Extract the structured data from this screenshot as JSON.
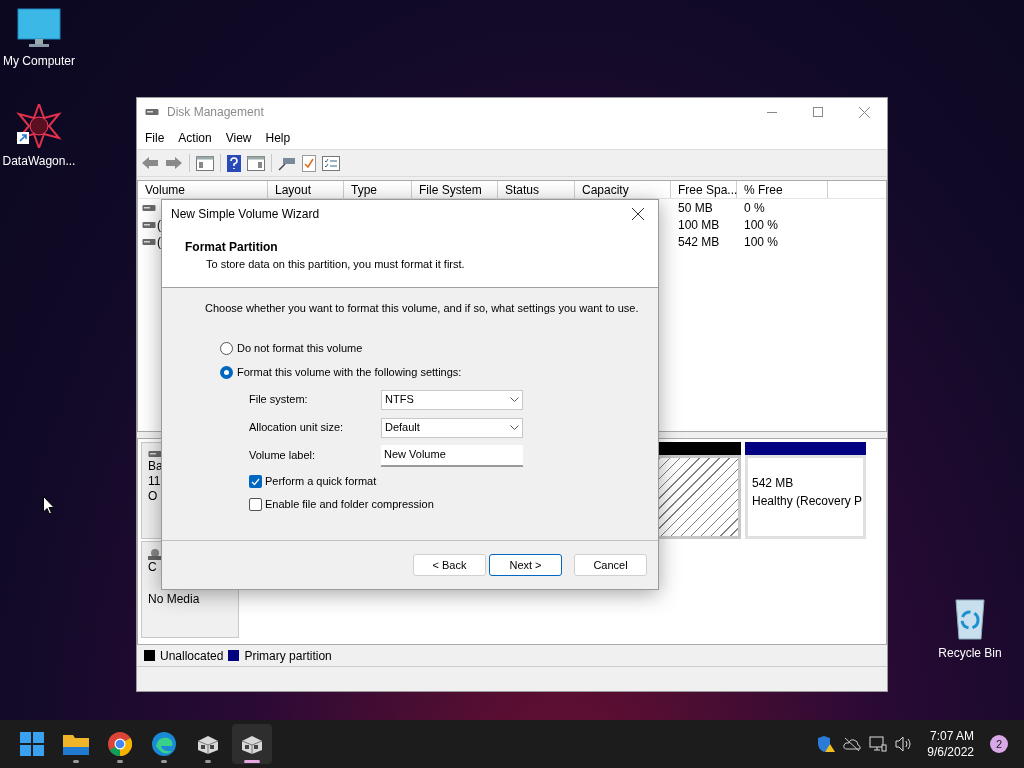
{
  "desktop_icons": [
    {
      "kind": "computer",
      "label": "My Computer"
    },
    {
      "kind": "shortcut",
      "label": "DataWagon..."
    },
    {
      "kind": "recycle",
      "label": "Recycle Bin"
    }
  ],
  "disk_management": {
    "title": "Disk Management",
    "menu": [
      "File",
      "Action",
      "View",
      "Help"
    ],
    "columns": [
      "Volume",
      "Layout",
      "Type",
      "File System",
      "Status",
      "Capacity",
      "Free Spa...",
      "% Free"
    ],
    "rows": [
      {
        "free_space": "50 MB",
        "percent_free": "0 %"
      },
      {
        "volume": "(",
        "free_space": "100 MB",
        "percent_free": "100 %"
      },
      {
        "volume": "(",
        "free_space": "542 MB",
        "percent_free": "100 %"
      }
    ],
    "disks": [
      {
        "kind": "disk",
        "label_lines": [
          "Ba",
          "11",
          "O"
        ],
        "partitions": [
          {
            "kind": "hatched",
            "color": "#000000"
          },
          {
            "kind": "plain",
            "color": "#000080",
            "size": "542 MB",
            "status": "Healthy (Recovery P"
          }
        ]
      },
      {
        "kind": "cdrom",
        "label_lines": [
          "C"
        ],
        "media": "No Media"
      }
    ],
    "legend": [
      {
        "label": "Unallocated",
        "color": "#000000"
      },
      {
        "label": "Primary partition",
        "color": "#000080"
      }
    ]
  },
  "wizard": {
    "title": "New Simple Volume Wizard",
    "heading": "Format Partition",
    "subheading": "To store data on this partition, you must format it first.",
    "instruction": "Choose whether you want to format this volume, and if so, what settings you want to use.",
    "options": [
      {
        "label": "Do not format this volume",
        "selected": false
      },
      {
        "label": "Format this volume with the following settings:",
        "selected": true
      }
    ],
    "fields": [
      {
        "kind": "dropdown",
        "label": "File system:",
        "value": "NTFS"
      },
      {
        "kind": "dropdown",
        "label": "Allocation unit size:",
        "value": "Default"
      },
      {
        "kind": "text",
        "label": "Volume label:",
        "value": "New Volume"
      }
    ],
    "checkboxes": [
      {
        "label": "Perform a quick format",
        "checked": true
      },
      {
        "label": "Enable file and folder compression",
        "checked": false
      }
    ],
    "buttons": [
      {
        "label": "< Back",
        "default": false
      },
      {
        "label": "Next >",
        "default": true
      },
      {
        "label": "Cancel",
        "default": false
      }
    ]
  },
  "taskbar": {
    "apps": [
      {
        "kind": "start",
        "running": false,
        "selected": false
      },
      {
        "kind": "folder",
        "running": true,
        "selected": false
      },
      {
        "kind": "chrome",
        "running": true,
        "selected": false
      },
      {
        "kind": "edge",
        "running": true,
        "selected": false
      },
      {
        "kind": "disk",
        "running": true,
        "selected": false
      },
      {
        "kind": "disk",
        "running": true,
        "selected": true
      }
    ],
    "time": "7:07 AM",
    "date": "9/6/2022",
    "notifications": "2"
  }
}
